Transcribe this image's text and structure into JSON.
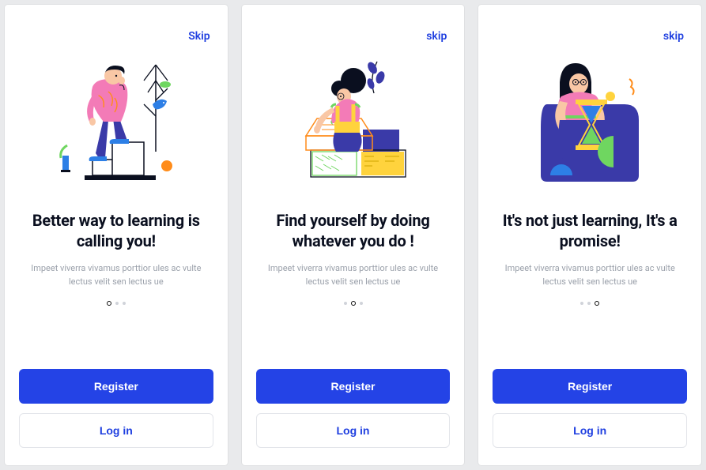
{
  "colors": {
    "accent": "#2443e6",
    "link": "#1f3fe0",
    "text": "#0a0f1f",
    "muted": "#9aa0aa",
    "bg": "#e9eaec",
    "pink": "#f37bb7",
    "purple": "#3a3aa8",
    "green": "#6fd660",
    "yellow": "#ffd33d",
    "orange": "#ff8c1a"
  },
  "screens": [
    {
      "skip_label": "Skip",
      "title": "Better way to learning\nis calling you!",
      "subtitle": "Impeet viverra vivamus porttior ules ac vulte\nlectus velit sen lectus ue",
      "dots": {
        "total": 3,
        "active": 0
      },
      "register_label": "Register",
      "login_label": "Log in",
      "illustration": "person-steps-bird"
    },
    {
      "skip_label": "skip",
      "title": "Find yourself  by doing\nwhatever you do !",
      "subtitle": "Impeet viverra vivamus porttior ules ac vulte\nlectus velit sen lectus ue",
      "dots": {
        "total": 3,
        "active": 1
      },
      "register_label": "Register",
      "login_label": "Log in",
      "illustration": "person-reading-box"
    },
    {
      "skip_label": "skip",
      "title": "It's not just learning,\nIt's a promise!",
      "subtitle": "Impeet viverra vivamus porttior ules ac vulte\nlectus velit sen lectus ue",
      "dots": {
        "total": 3,
        "active": 2
      },
      "register_label": "Register",
      "login_label": "Log in",
      "illustration": "person-hourglass-chair"
    }
  ]
}
